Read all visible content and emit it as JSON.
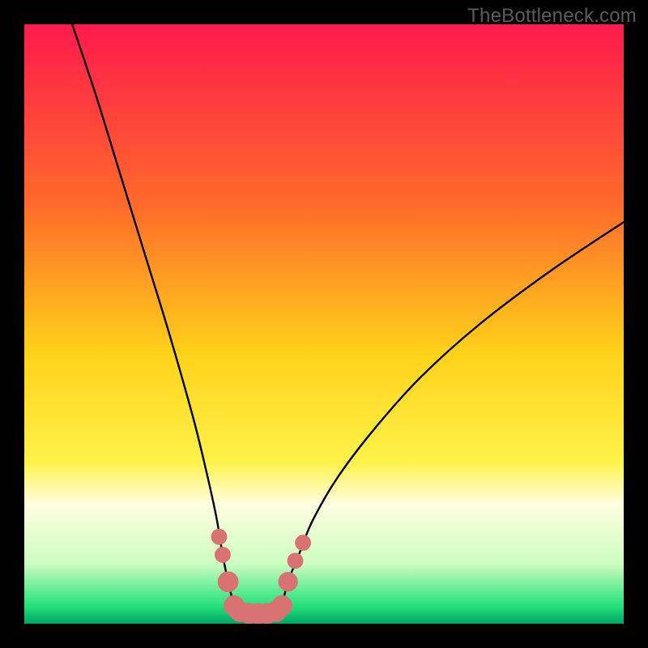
{
  "watermark": "TheBottleneck.com",
  "chart_data": {
    "type": "line",
    "title": "",
    "xlabel": "",
    "ylabel": "",
    "xlim": [
      0,
      100
    ],
    "ylim": [
      0,
      100
    ],
    "grid": false,
    "legend": false,
    "annotations": [],
    "gradient_stops": [
      {
        "offset": 0.0,
        "color": "#ff1a4d"
      },
      {
        "offset": 0.3,
        "color": "#ff6a2a"
      },
      {
        "offset": 0.55,
        "color": "#ffd21a"
      },
      {
        "offset": 0.73,
        "color": "#fff24a"
      },
      {
        "offset": 0.8,
        "color": "#fffde0"
      },
      {
        "offset": 0.9,
        "color": "#cdfdc0"
      },
      {
        "offset": 0.97,
        "color": "#25e27a"
      },
      {
        "offset": 1.0,
        "color": "#00a765"
      }
    ],
    "series": [
      {
        "name": "bottleneck-left",
        "color": "#000000",
        "x": [
          8,
          12,
          16,
          20,
          24,
          28,
          30,
          32,
          33,
          34,
          35
        ],
        "y": [
          100,
          88,
          75,
          62,
          49,
          35,
          27,
          18,
          12,
          7,
          3
        ]
      },
      {
        "name": "bottleneck-right",
        "color": "#000000",
        "x": [
          43,
          44,
          46,
          48,
          52,
          58,
          66,
          76,
          88,
          100
        ],
        "y": [
          3,
          7,
          12,
          17,
          24,
          32,
          41,
          50,
          59,
          67
        ]
      }
    ],
    "markers": [
      {
        "series": "left",
        "x": 32.5,
        "y": 14.5,
        "r": 1.6
      },
      {
        "series": "left",
        "x": 33.1,
        "y": 11.5,
        "r": 1.6
      },
      {
        "series": "left",
        "x": 34.0,
        "y": 7.0,
        "r": 2.4
      },
      {
        "series": "left",
        "x": 35.0,
        "y": 3.0,
        "r": 2.4
      },
      {
        "series": "floor",
        "x": 36.0,
        "y": 2.0,
        "r": 2.4
      },
      {
        "series": "floor",
        "x": 37.5,
        "y": 1.7,
        "r": 2.4
      },
      {
        "series": "floor",
        "x": 39.0,
        "y": 1.7,
        "r": 2.4
      },
      {
        "series": "floor",
        "x": 40.5,
        "y": 1.7,
        "r": 2.4
      },
      {
        "series": "floor",
        "x": 42.0,
        "y": 2.0,
        "r": 2.4
      },
      {
        "series": "right",
        "x": 43.0,
        "y": 3.0,
        "r": 2.4
      },
      {
        "series": "right",
        "x": 44.0,
        "y": 7.0,
        "r": 2.2
      },
      {
        "series": "right",
        "x": 45.2,
        "y": 10.5,
        "r": 1.6
      },
      {
        "series": "right",
        "x": 46.5,
        "y": 13.5,
        "r": 1.6
      }
    ],
    "marker_color": "#d97272",
    "floor_segment": {
      "x0": 35,
      "x1": 43,
      "y": 2
    }
  }
}
